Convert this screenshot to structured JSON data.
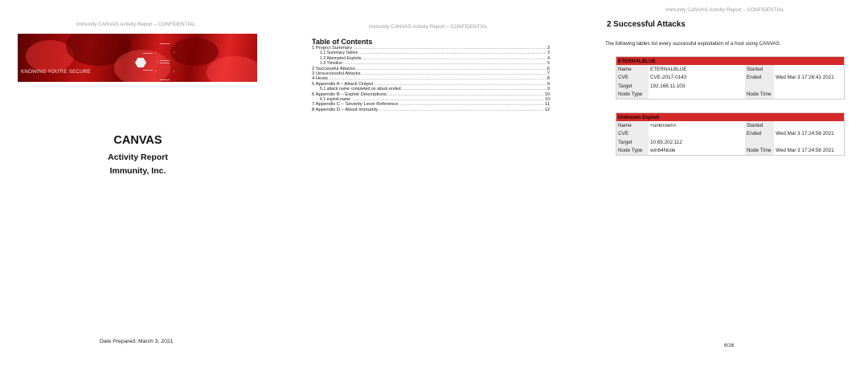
{
  "header_text": "Immunity CANVAS Activity Report – CONFIDENTIAL",
  "cover": {
    "banner_motto": "KNOWING YOU'RE SECURE",
    "title": "CANVAS",
    "subtitle": "Activity Report",
    "company": "Immunity, Inc.",
    "date_prepared": "Date Prepared: March 3, 2021"
  },
  "toc": {
    "title": "Table of Contents",
    "entries": [
      {
        "label": "1 Project Summary",
        "page": "3",
        "level": 1
      },
      {
        "label": "1.1 Summary Tables",
        "page": "3",
        "level": 2
      },
      {
        "label": "1.2 Attempted Exploits",
        "page": "4",
        "level": 2
      },
      {
        "label": "1.3 Timeline",
        "page": "5",
        "level": 2
      },
      {
        "label": "2 Successful Attacks",
        "page": "6",
        "level": 1
      },
      {
        "label": "3 Unsuccessful Attacks",
        "page": "7",
        "level": 1
      },
      {
        "label": "4 Hosts",
        "page": "8",
        "level": 1
      },
      {
        "label": "5 Appendix A – Attack Output",
        "page": "9",
        "level": 1
      },
      {
        "label": "5.1 attack.name completed on attack.ended",
        "page": "9",
        "level": 2
      },
      {
        "label": "6 Appendix B – Exploit Descriptions",
        "page": "10",
        "level": 1
      },
      {
        "label": "6.1 exploit.name",
        "page": "10",
        "level": 2
      },
      {
        "label": "7 Appendix C – Severity Level Reference",
        "page": "11",
        "level": 1
      },
      {
        "label": "8 Appendix D – About Immunity",
        "page": "12",
        "level": 1
      }
    ]
  },
  "section": {
    "title": "2  Successful Attacks",
    "intro": "The following tables list every successful exploitation of a host using CANVAS.",
    "attacks": [
      {
        "name": "ETERNALBLUE",
        "rows": [
          {
            "k": "Name",
            "v": "ETERNALBLUE",
            "k2": "Started",
            "v2": ""
          },
          {
            "k": "CVE",
            "v": "CVE-2017-0143",
            "k2": "Ended",
            "v2": "Wed Mar 3 17:26:41 2021"
          },
          {
            "k": "Target",
            "v": "192.168.11.103",
            "k2": "",
            "v2": ""
          },
          {
            "k": "Node Type",
            "v": "",
            "k2": "Node Time",
            "v2": ""
          }
        ]
      },
      {
        "name": "Unknown Exploit",
        "rows": [
          {
            "k": "Name",
            "v": "<unknown>",
            "k2": "Started",
            "v2": ""
          },
          {
            "k": "CVE",
            "v": "",
            "k2": "Ended",
            "v2": "Wed Mar 3 17:24:58 2021"
          },
          {
            "k": "Target",
            "v": "10.65.202.112",
            "k2": "",
            "v2": ""
          },
          {
            "k": "Node Type",
            "v": "win64Node",
            "k2": "Node Time",
            "v2": "Wed Mar 3 17:24:58 2021"
          }
        ]
      }
    ],
    "page_number": "6/16"
  }
}
